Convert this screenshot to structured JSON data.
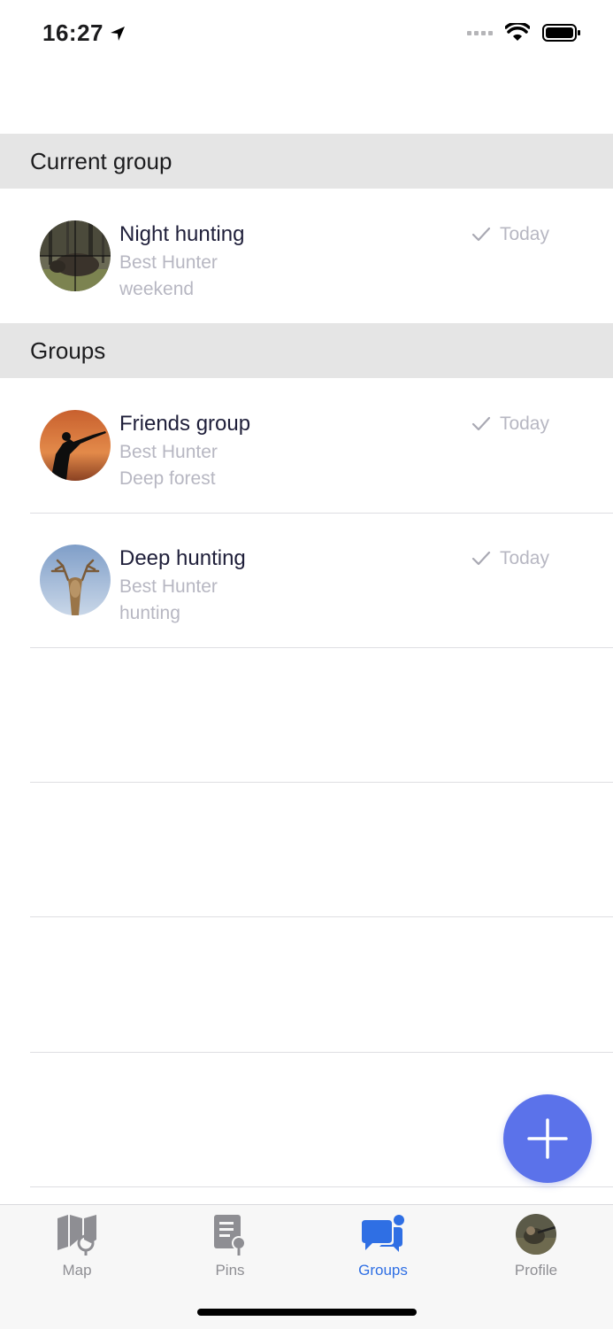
{
  "status_bar": {
    "time": "16:27"
  },
  "sections": {
    "current_group": "Current group",
    "groups": "Groups"
  },
  "current_group": {
    "title": "Night hunting",
    "subtitle1": "Best Hunter",
    "subtitle2": "weekend",
    "status": "Today"
  },
  "groups": [
    {
      "title": "Friends group",
      "subtitle1": "Best Hunter",
      "subtitle2": "Deep forest",
      "status": "Today"
    },
    {
      "title": "Deep hunting",
      "subtitle1": "Best Hunter",
      "subtitle2": "hunting",
      "status": "Today"
    }
  ],
  "tab_bar": {
    "items": [
      {
        "label": "Map",
        "icon": "map-icon"
      },
      {
        "label": "Pins",
        "icon": "pins-icon"
      },
      {
        "label": "Groups",
        "icon": "groups-icon",
        "active": true
      },
      {
        "label": "Profile",
        "icon": "profile-avatar"
      }
    ]
  },
  "colors": {
    "accent": "#2f6fe4",
    "fab": "#5b72ea",
    "section_bg": "#e5e5e5"
  }
}
